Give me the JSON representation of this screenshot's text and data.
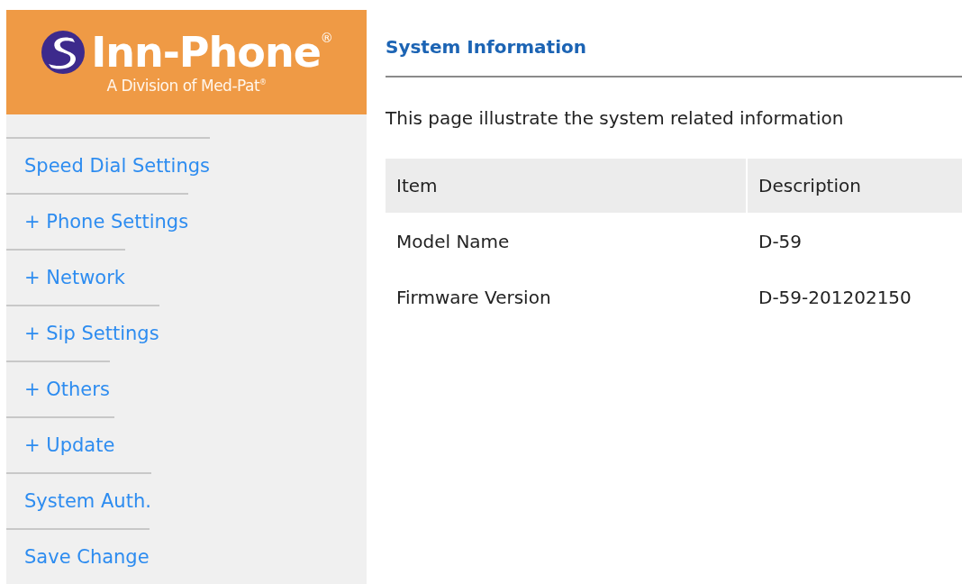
{
  "logo": {
    "name": "Inn-Phone$^{®}$",
    "tagline": "A Division of Med-Pat$^{®}$"
  },
  "sidebar": {
    "items": [
      {
        "label": "Speed Dial Settings"
      },
      {
        "label": "+ Phone Settings"
      },
      {
        "label": "+ Network"
      },
      {
        "label": "+ Sip Settings"
      },
      {
        "label": "+ Others"
      },
      {
        "label": "+ Update"
      },
      {
        "label": "System Auth."
      },
      {
        "label": "Save Change"
      }
    ]
  },
  "main": {
    "title": "System Information",
    "description": "This page illustrate the system related information",
    "table": {
      "columns": [
        "Item",
        "Description"
      ],
      "rows": [
        [
          "Model Name",
          "D-59"
        ],
        [
          "Firmware Version",
          "D-59-201202150"
        ]
      ]
    }
  }
}
